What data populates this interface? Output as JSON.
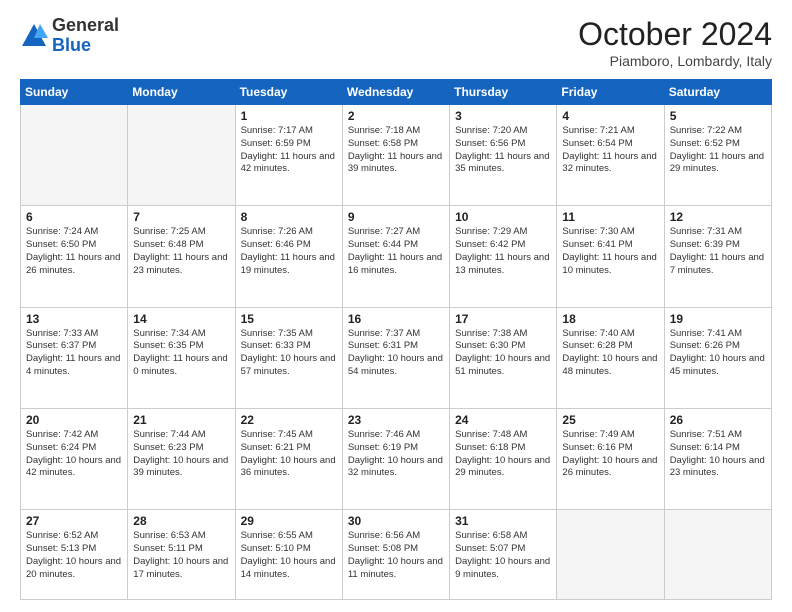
{
  "header": {
    "logo_general": "General",
    "logo_blue": "Blue",
    "title": "October 2024",
    "location": "Piamboro, Lombardy, Italy"
  },
  "days_of_week": [
    "Sunday",
    "Monday",
    "Tuesday",
    "Wednesday",
    "Thursday",
    "Friday",
    "Saturday"
  ],
  "weeks": [
    [
      {
        "day": "",
        "content": ""
      },
      {
        "day": "",
        "content": ""
      },
      {
        "day": "1",
        "content": "Sunrise: 7:17 AM\nSunset: 6:59 PM\nDaylight: 11 hours and 42 minutes."
      },
      {
        "day": "2",
        "content": "Sunrise: 7:18 AM\nSunset: 6:58 PM\nDaylight: 11 hours and 39 minutes."
      },
      {
        "day": "3",
        "content": "Sunrise: 7:20 AM\nSunset: 6:56 PM\nDaylight: 11 hours and 35 minutes."
      },
      {
        "day": "4",
        "content": "Sunrise: 7:21 AM\nSunset: 6:54 PM\nDaylight: 11 hours and 32 minutes."
      },
      {
        "day": "5",
        "content": "Sunrise: 7:22 AM\nSunset: 6:52 PM\nDaylight: 11 hours and 29 minutes."
      }
    ],
    [
      {
        "day": "6",
        "content": "Sunrise: 7:24 AM\nSunset: 6:50 PM\nDaylight: 11 hours and 26 minutes."
      },
      {
        "day": "7",
        "content": "Sunrise: 7:25 AM\nSunset: 6:48 PM\nDaylight: 11 hours and 23 minutes."
      },
      {
        "day": "8",
        "content": "Sunrise: 7:26 AM\nSunset: 6:46 PM\nDaylight: 11 hours and 19 minutes."
      },
      {
        "day": "9",
        "content": "Sunrise: 7:27 AM\nSunset: 6:44 PM\nDaylight: 11 hours and 16 minutes."
      },
      {
        "day": "10",
        "content": "Sunrise: 7:29 AM\nSunset: 6:42 PM\nDaylight: 11 hours and 13 minutes."
      },
      {
        "day": "11",
        "content": "Sunrise: 7:30 AM\nSunset: 6:41 PM\nDaylight: 11 hours and 10 minutes."
      },
      {
        "day": "12",
        "content": "Sunrise: 7:31 AM\nSunset: 6:39 PM\nDaylight: 11 hours and 7 minutes."
      }
    ],
    [
      {
        "day": "13",
        "content": "Sunrise: 7:33 AM\nSunset: 6:37 PM\nDaylight: 11 hours and 4 minutes."
      },
      {
        "day": "14",
        "content": "Sunrise: 7:34 AM\nSunset: 6:35 PM\nDaylight: 11 hours and 0 minutes."
      },
      {
        "day": "15",
        "content": "Sunrise: 7:35 AM\nSunset: 6:33 PM\nDaylight: 10 hours and 57 minutes."
      },
      {
        "day": "16",
        "content": "Sunrise: 7:37 AM\nSunset: 6:31 PM\nDaylight: 10 hours and 54 minutes."
      },
      {
        "day": "17",
        "content": "Sunrise: 7:38 AM\nSunset: 6:30 PM\nDaylight: 10 hours and 51 minutes."
      },
      {
        "day": "18",
        "content": "Sunrise: 7:40 AM\nSunset: 6:28 PM\nDaylight: 10 hours and 48 minutes."
      },
      {
        "day": "19",
        "content": "Sunrise: 7:41 AM\nSunset: 6:26 PM\nDaylight: 10 hours and 45 minutes."
      }
    ],
    [
      {
        "day": "20",
        "content": "Sunrise: 7:42 AM\nSunset: 6:24 PM\nDaylight: 10 hours and 42 minutes."
      },
      {
        "day": "21",
        "content": "Sunrise: 7:44 AM\nSunset: 6:23 PM\nDaylight: 10 hours and 39 minutes."
      },
      {
        "day": "22",
        "content": "Sunrise: 7:45 AM\nSunset: 6:21 PM\nDaylight: 10 hours and 36 minutes."
      },
      {
        "day": "23",
        "content": "Sunrise: 7:46 AM\nSunset: 6:19 PM\nDaylight: 10 hours and 32 minutes."
      },
      {
        "day": "24",
        "content": "Sunrise: 7:48 AM\nSunset: 6:18 PM\nDaylight: 10 hours and 29 minutes."
      },
      {
        "day": "25",
        "content": "Sunrise: 7:49 AM\nSunset: 6:16 PM\nDaylight: 10 hours and 26 minutes."
      },
      {
        "day": "26",
        "content": "Sunrise: 7:51 AM\nSunset: 6:14 PM\nDaylight: 10 hours and 23 minutes."
      }
    ],
    [
      {
        "day": "27",
        "content": "Sunrise: 6:52 AM\nSunset: 5:13 PM\nDaylight: 10 hours and 20 minutes."
      },
      {
        "day": "28",
        "content": "Sunrise: 6:53 AM\nSunset: 5:11 PM\nDaylight: 10 hours and 17 minutes."
      },
      {
        "day": "29",
        "content": "Sunrise: 6:55 AM\nSunset: 5:10 PM\nDaylight: 10 hours and 14 minutes."
      },
      {
        "day": "30",
        "content": "Sunrise: 6:56 AM\nSunset: 5:08 PM\nDaylight: 10 hours and 11 minutes."
      },
      {
        "day": "31",
        "content": "Sunrise: 6:58 AM\nSunset: 5:07 PM\nDaylight: 10 hours and 9 minutes."
      },
      {
        "day": "",
        "content": ""
      },
      {
        "day": "",
        "content": ""
      }
    ]
  ]
}
